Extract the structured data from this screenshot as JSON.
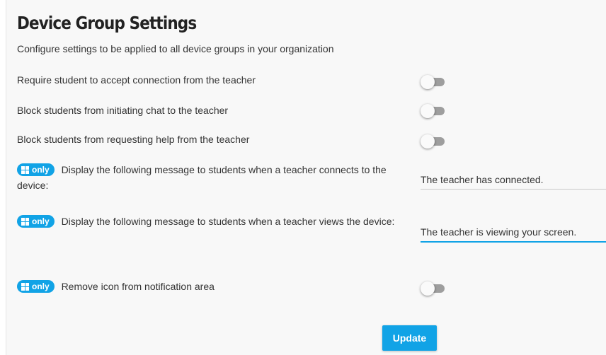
{
  "header": {
    "title": "Device Group Settings",
    "subtitle": "Configure settings to be applied to all device groups in your organization"
  },
  "settings": {
    "require_accept": {
      "label": "Require student to accept connection from the teacher",
      "enabled": false
    },
    "block_chat": {
      "label": "Block students from initiating chat to the teacher",
      "enabled": false
    },
    "block_help": {
      "label": "Block students from requesting help from the teacher",
      "enabled": false
    },
    "connect_message": {
      "badge": "only",
      "badge_icon": "windows-icon",
      "label_line1": "Display the following message to students when a teacher connects to the",
      "label_line2": "device:",
      "value": "The teacher has connected."
    },
    "view_message": {
      "badge": "only",
      "badge_icon": "windows-icon",
      "label": "Display the following message to students when a teacher views the device:",
      "value": "The teacher is viewing your screen."
    },
    "remove_icon": {
      "badge": "only",
      "badge_icon": "windows-icon",
      "label": "Remove icon from notification area",
      "enabled": false
    }
  },
  "actions": {
    "update_label": "Update"
  },
  "colors": {
    "accent": "#11a3e6",
    "toggle_off_track": "#9e9e9e",
    "field_line_idle": "#c8c8c8"
  }
}
